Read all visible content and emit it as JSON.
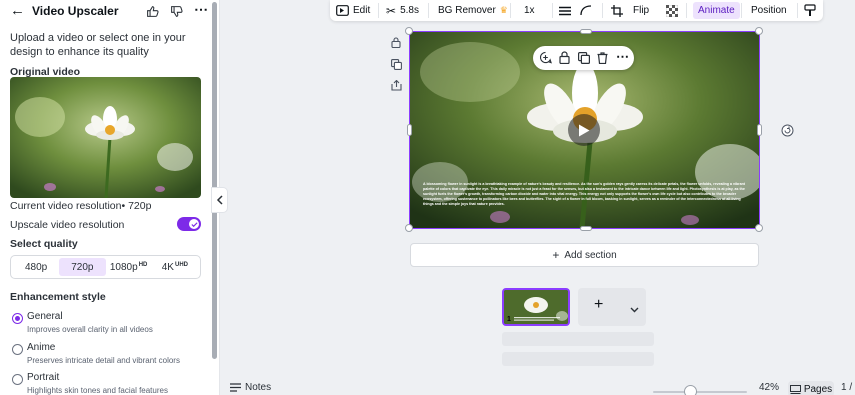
{
  "panel": {
    "title": "Video Upscaler",
    "description": "Upload a video or select one in your design to enhance its quality",
    "original_video_heading": "Original video",
    "current_resolution": "Current video resolution• 720p",
    "upscale_label": "Upscale video resolution",
    "upscale_enabled": true,
    "select_quality_heading": "Select quality",
    "quality_options": [
      {
        "label": "480p",
        "badge": "",
        "selected": false
      },
      {
        "label": "720p",
        "badge": "",
        "selected": true
      },
      {
        "label": "1080p",
        "badge": "HD",
        "selected": false
      },
      {
        "label": "4K",
        "badge": "UHD",
        "selected": false
      }
    ],
    "enhancement_heading": "Enhancement style",
    "styles": [
      {
        "label": "General",
        "sub": "Improves overall clarity in all videos",
        "selected": true
      },
      {
        "label": "Anime",
        "sub": "Preserves intricate detail and vibrant colors",
        "selected": false
      },
      {
        "label": "Portrait",
        "sub": "Highlights skin tones and facial features",
        "selected": false
      }
    ]
  },
  "toolbar": {
    "edit": "Edit",
    "duration": "5.8s",
    "bg_remover": "BG Remover",
    "speed": "1x",
    "flip": "Flip",
    "animate": "Animate",
    "position": "Position"
  },
  "canvas": {
    "caption": "A blossoming flower in sunlight is a breathtaking example of nature's beauty and resilience. As the sun's golden rays gently caress its delicate petals, the flower unfolds, revealing a vibrant palette of colors that captivate the eye. This daily miracle is not just a feast for the senses, but also a testament to the intricate dance between life and light. Photosynthesis is at play, as the sunlight fuels the flower's growth, transforming carbon dioxide and water into vital energy. This energy not only supports the flower's own life cycle but also contributes to the broader ecosystem, offering sustenance to pollinators like bees and butterflies. The sight of a flower in full bloom, basking in sunlight, serves as a reminder of the interconnectedness of all living things and the simple joys that nature provides.",
    "add_section": "Add section",
    "page_number": "1"
  },
  "bottom": {
    "notes": "Notes",
    "zoom": "42%",
    "zoom_level": 0.42,
    "pages": "Pages",
    "page_indicator": "1 /"
  },
  "colors": {
    "accent": "#8b3dff",
    "toggle": "#7d2ae8",
    "selected_segment": "#ede2fd"
  }
}
